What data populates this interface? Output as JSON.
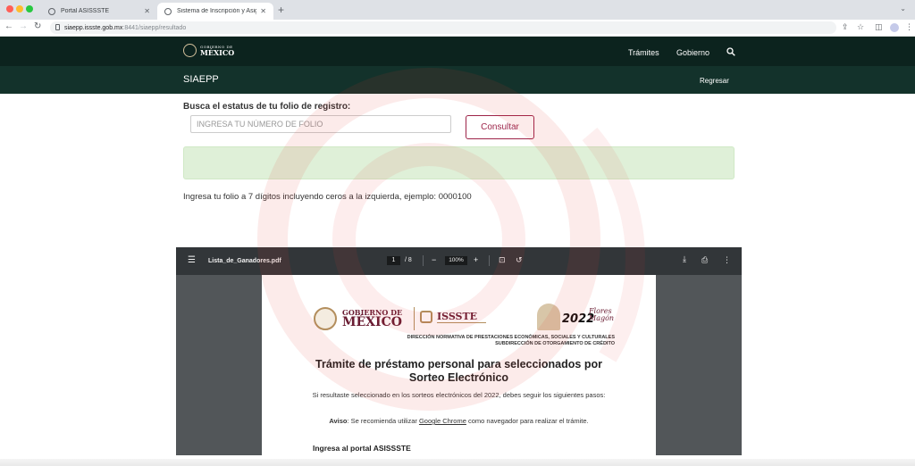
{
  "browser": {
    "tabs": [
      {
        "label": "Portal ASISSSTE"
      },
      {
        "label": "Sistema de Inscripción y Asign"
      }
    ],
    "url_host": "siaepp.issste.gob.mx",
    "url_path": ":8441/siaepp/resultado"
  },
  "gov_header": {
    "logo_small": "GOBIERNO DE",
    "logo_big": "MÉXICO",
    "links": [
      "Trámites",
      "Gobierno"
    ]
  },
  "subbar": {
    "title": "SIAEPP",
    "back": "Regresar"
  },
  "form": {
    "label": "Busca el estatus de tu folio de registro:",
    "placeholder": "INGRESA TU NÚMERO DE FOLIO",
    "button": "Consultar",
    "hint": "Ingresa tu folio a 7 dígitos incluyendo ceros a la izquierda, ejemplo: 0000100"
  },
  "pdf": {
    "filename": "Lista_de_Ganadores.pdf",
    "page_current": "1",
    "page_total": "/ 8",
    "zoom": "100%",
    "doc": {
      "gob_a": "GOBIERNO DE",
      "gob_b": "MÉXICO",
      "issste": "ISSSTE",
      "year": "2022",
      "flores": "Flores",
      "magon": "Magón",
      "dir_line1": "DIRECCIÓN NORMATIVA DE PRESTACIONES ECONÓMICAS, SOCIALES Y CULTURALES",
      "dir_line2": "SUBDIRECCIÓN DE OTORGAMIENTO DE CRÉDITO",
      "title": "Trámite de préstamo personal para seleccionados por Sorteo Electrónico",
      "p1": "Si resultaste seleccionado en los sorteos electrónicos del 2022, debes seguir los siguientes pasos:",
      "p2_bold": "Aviso",
      "p2_a": ": Se recomienda utilizar ",
      "p2_link": "Google Chrome",
      "p2_b": " como navegador para realizar el trámite.",
      "h2": "Ingresa al portal ASISSSTE"
    }
  },
  "colors": {
    "gov_dark": "#0c231e",
    "gov_sub": "#13322b",
    "accent": "#9d2449",
    "alert_bg": "#dff0d8"
  }
}
